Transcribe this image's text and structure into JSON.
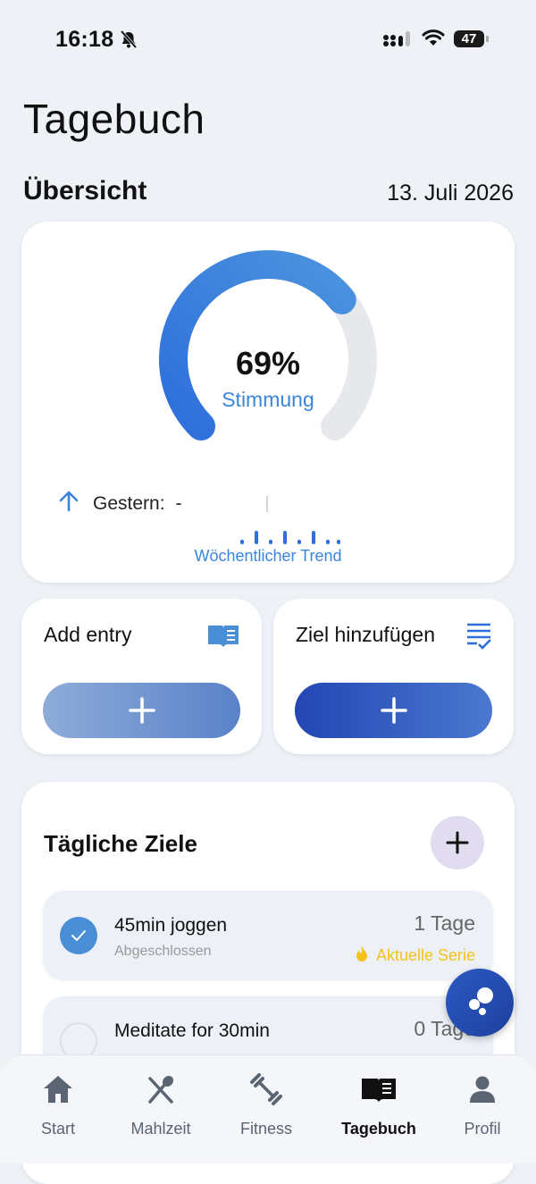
{
  "status": {
    "time": "16:18",
    "battery": "47"
  },
  "page": {
    "title": "Tagebuch",
    "section": "Übersicht",
    "date": "13. Juli 2026"
  },
  "mood": {
    "percent_label": "69%",
    "percent_value": 69,
    "label": "Stimmung",
    "yesterday_label": "Gestern:",
    "yesterday_value": "-",
    "trend_label": "Wöchentlicher Trend"
  },
  "actions": {
    "add_entry": "Add entry",
    "add_goal": "Ziel hinzufügen"
  },
  "goals": {
    "title": "Tägliche Ziele",
    "items": [
      {
        "name": "45min joggen",
        "status": "Abgeschlossen",
        "days": "1 Tage",
        "streak": "Aktuelle Serie",
        "done": true
      },
      {
        "name": "Meditate for 30min",
        "days": "0 Tage",
        "done": false
      }
    ]
  },
  "tabs": [
    {
      "label": "Start",
      "icon": "home-icon"
    },
    {
      "label": "Mahlzeit",
      "icon": "utensils-icon"
    },
    {
      "label": "Fitness",
      "icon": "dumbbell-icon"
    },
    {
      "label": "Tagebuch",
      "icon": "book-icon",
      "active": true
    },
    {
      "label": "Profil",
      "icon": "person-icon"
    }
  ],
  "colors": {
    "accent": "#3a86dc",
    "primary_dark": "#2346b4",
    "streak": "#f4c21b",
    "background": "#eef2f7"
  }
}
